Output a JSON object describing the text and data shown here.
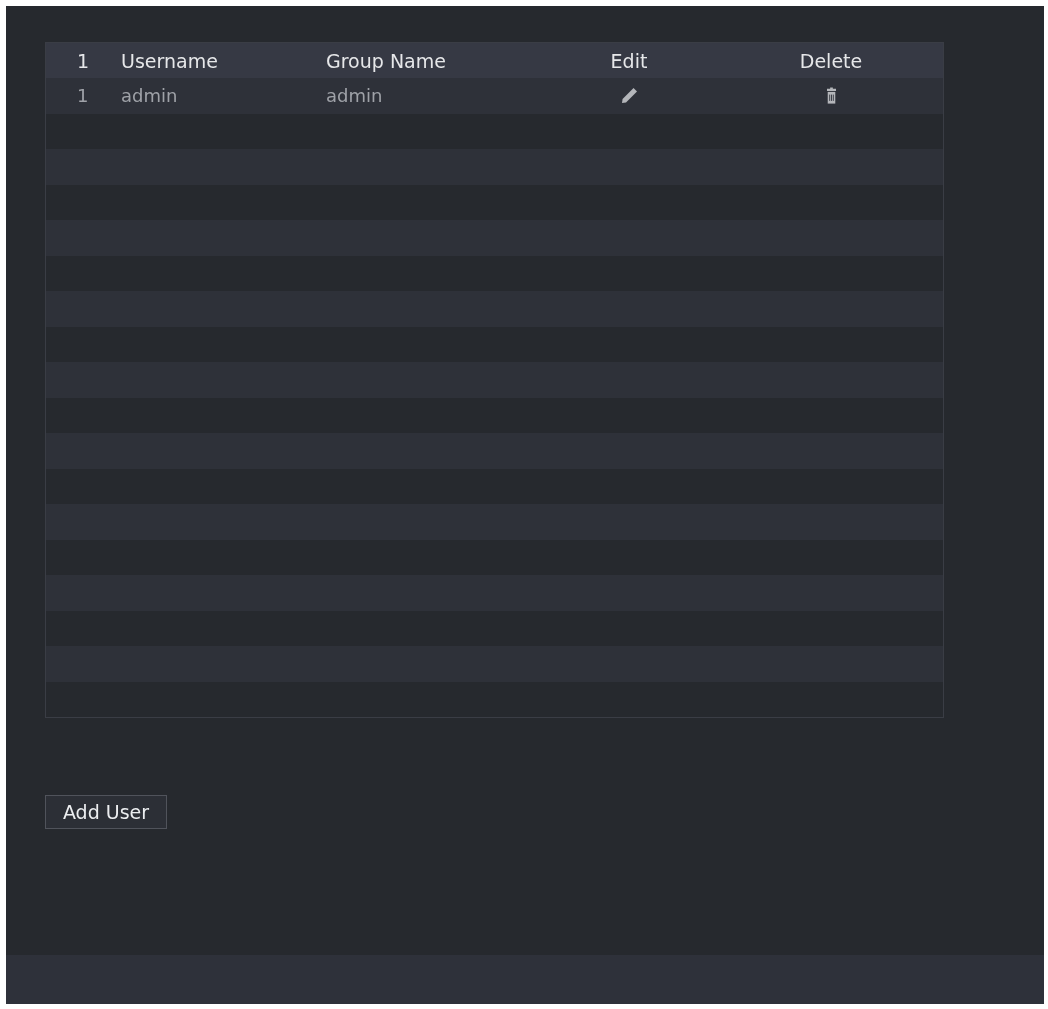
{
  "table": {
    "columns": [
      {
        "label": "1"
      },
      {
        "label": "Username"
      },
      {
        "label": "Group Name"
      },
      {
        "label": "Edit"
      },
      {
        "label": "Delete"
      }
    ],
    "rows": [
      {
        "number": "1",
        "username": "admin",
        "group_name": "admin"
      }
    ]
  },
  "buttons": [
    {
      "label": "Add User"
    }
  ]
}
